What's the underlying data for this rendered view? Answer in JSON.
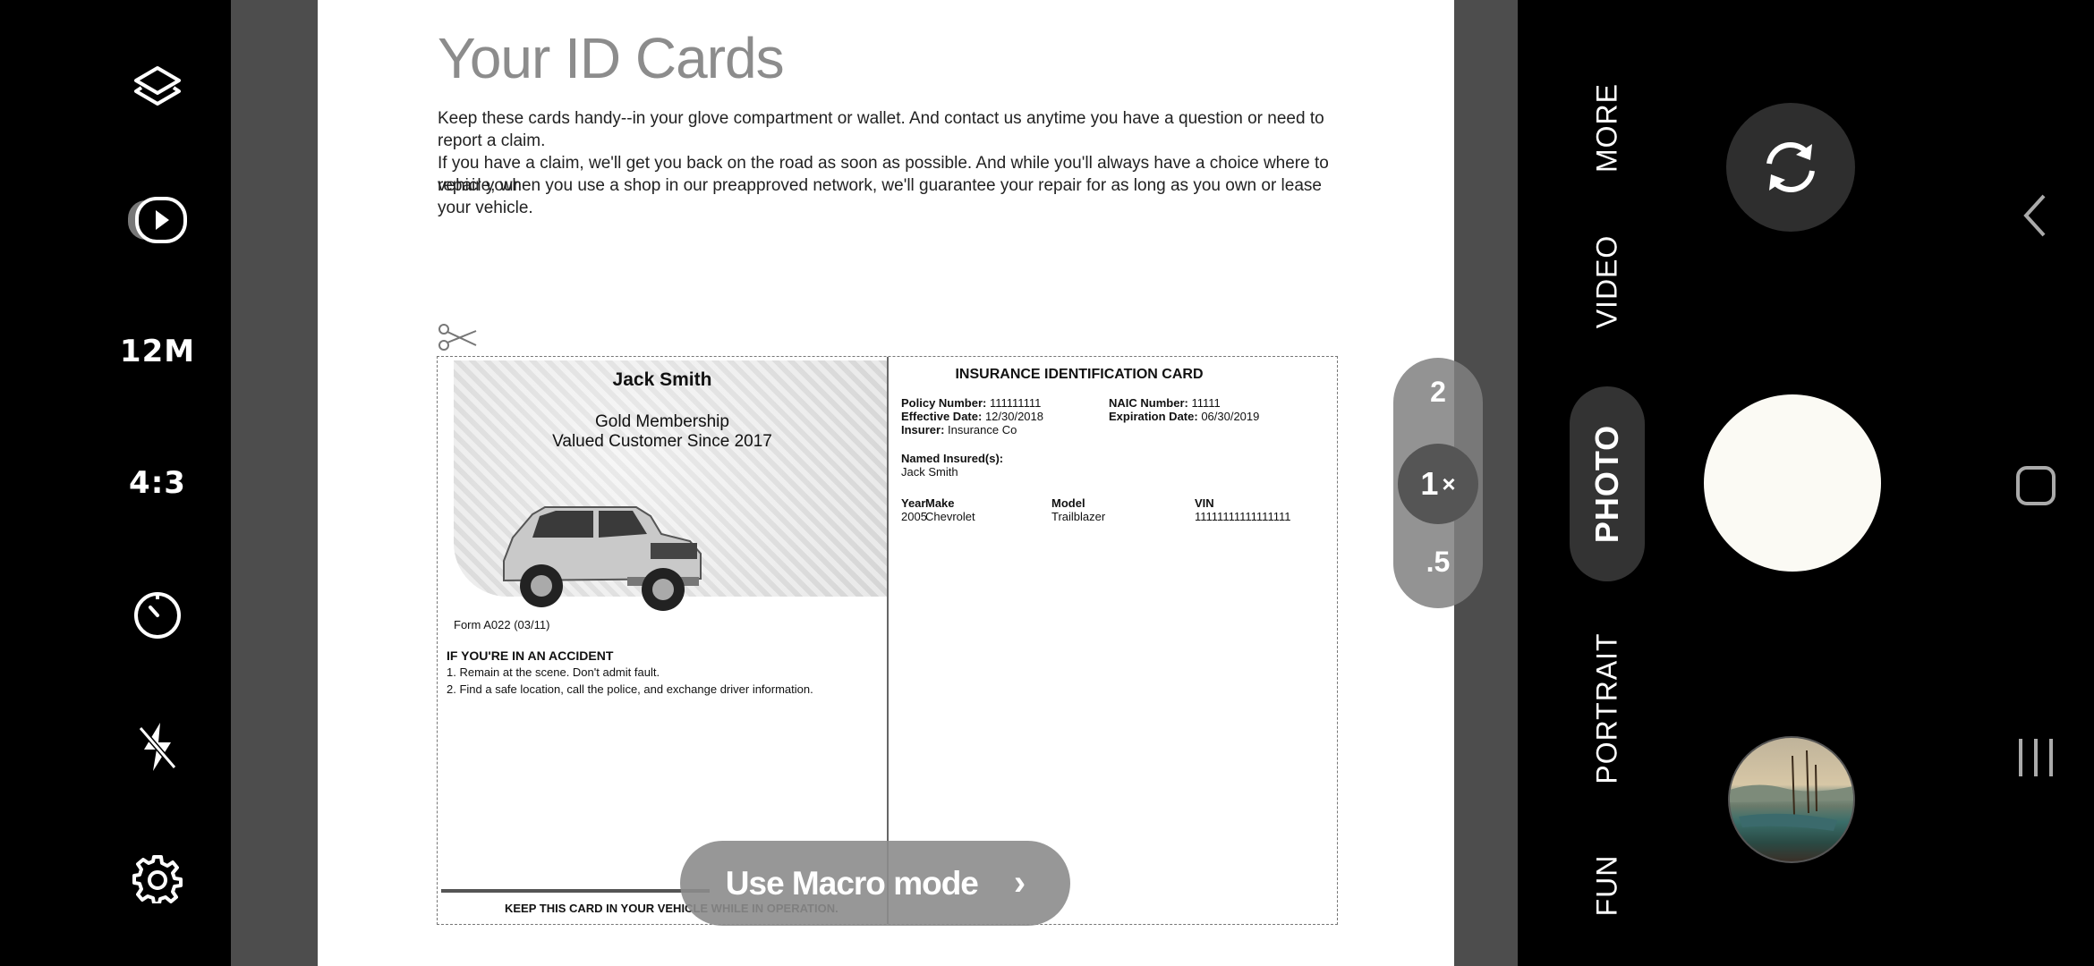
{
  "left_bar": {
    "resolution": "12M",
    "ratio": "4:3"
  },
  "document": {
    "title": "Your ID Cards",
    "para1": "Keep these cards handy--in your glove compartment or wallet. And contact us anytime you have a question or need to report a claim.",
    "para2_line1": "If you have a claim, we'll get you back on the road as soon as possible. And while you'll always have a choice where to repair your",
    "para2_line2": "vehicle, when you use a shop in our preapproved network, we'll guarantee your repair for as long as you own or lease your vehicle."
  },
  "card": {
    "name": "Jack Smith",
    "membership": "Gold Membership",
    "customer_since": "Valued Customer Since 2017",
    "form": "Form A022 (03/11)",
    "accident_heading": "IF YOU'RE IN AN ACCIDENT",
    "accident_1": "1.  Remain at the scene. Don't admit fault.",
    "accident_2": "2.  Find a safe location, call the police, and exchange driver information.",
    "keep_notice": "KEEP THIS CARD IN YOUR VEHICLE WHILE IN OPERATION.",
    "right_title": "INSURANCE IDENTIFICATION CARD",
    "policy_label": "Policy Number:",
    "policy_value": "111111111",
    "naic_label": "NAIC Number:",
    "naic_value": "11111",
    "effective_label": "Effective Date:",
    "effective_value": "12/30/2018",
    "expiration_label": "Expiration Date:",
    "expiration_value": "06/30/2019",
    "insurer_label": "Insurer:",
    "insurer_value": "Insurance Co",
    "named_label": "Named Insured(s):",
    "named_value": "Jack Smith",
    "col_year": "Year",
    "col_make": "Make",
    "col_model": "Model",
    "col_vin": "VIN",
    "val_year": "2005",
    "val_make": "Chevrolet",
    "val_model": "Trailblazer",
    "val_vin": "11111111111111111"
  },
  "zoom": {
    "z2": "2",
    "z1": "1",
    "z1_suffix": "×",
    "z05": ".5"
  },
  "macro": {
    "label": "Use Macro mode",
    "chevron": "›"
  },
  "modes": {
    "more": "MORE",
    "video": "VIDEO",
    "photo": "PHOTO",
    "portrait": "PORTRAIT",
    "fun": "FUN"
  },
  "icons": {
    "layers": "layers-icon",
    "motion": "motion-photo-icon",
    "timer": "timer-icon",
    "flash": "flash-off-icon",
    "settings": "gear-icon",
    "switch": "switch-camera-icon",
    "back": "back-icon",
    "home": "home-icon",
    "recents": "recents-icon"
  }
}
